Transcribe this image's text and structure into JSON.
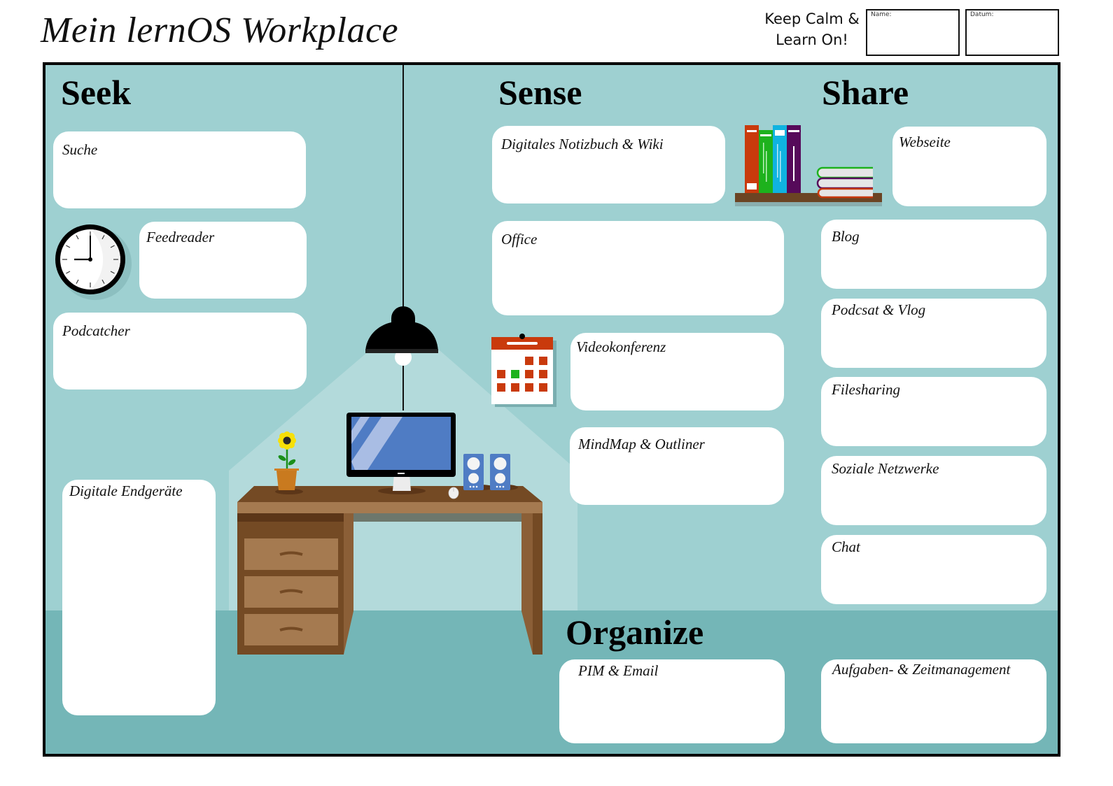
{
  "header": {
    "title": "Mein lernOS Workplace",
    "motto_line1": "Keep Calm &",
    "motto_line2": "Learn On!",
    "name_field_label": "Name:",
    "name_field_value": "",
    "date_field_label": "Datum:",
    "date_field_value": ""
  },
  "colors": {
    "wall": "#9ed0d1",
    "floor": "#74b6b7",
    "card": "#ffffff",
    "desk_top": "#a57a50",
    "desk_dark": "#744a24",
    "calendar_red": "#c93a0c",
    "calendar_today": "#1db21d",
    "monitor_screen": "#4f7cc4"
  },
  "sections": {
    "seek": {
      "heading": "Seek",
      "cards": [
        "Suche",
        "Feedreader",
        "Podcatcher",
        "Digitale Endgeräte"
      ]
    },
    "sense": {
      "heading": "Sense",
      "cards": [
        "Digitales Notizbuch & Wiki",
        "Office",
        "Videokonferenz",
        "MindMap & Outliner"
      ]
    },
    "share": {
      "heading": "Share",
      "cards": [
        "Webseite",
        "Blog",
        "Podcsat & Vlog",
        "Filesharing",
        "Soziale Netzwerke",
        "Chat"
      ]
    },
    "organize": {
      "heading": "Organize",
      "cards": [
        "PIM & Email",
        "Aufgaben- & Zeitmanagement"
      ]
    }
  },
  "illustrations": {
    "clock": "clock-icon",
    "bookshelf": "bookshelf-icon",
    "calendar": "calendar-icon",
    "lamp": "lamp-icon",
    "desk": "desk-icon",
    "monitor": "monitor-icon",
    "plant": "sunflower-icon",
    "speakers": "speaker-icon",
    "mouse": "mouse-icon"
  }
}
